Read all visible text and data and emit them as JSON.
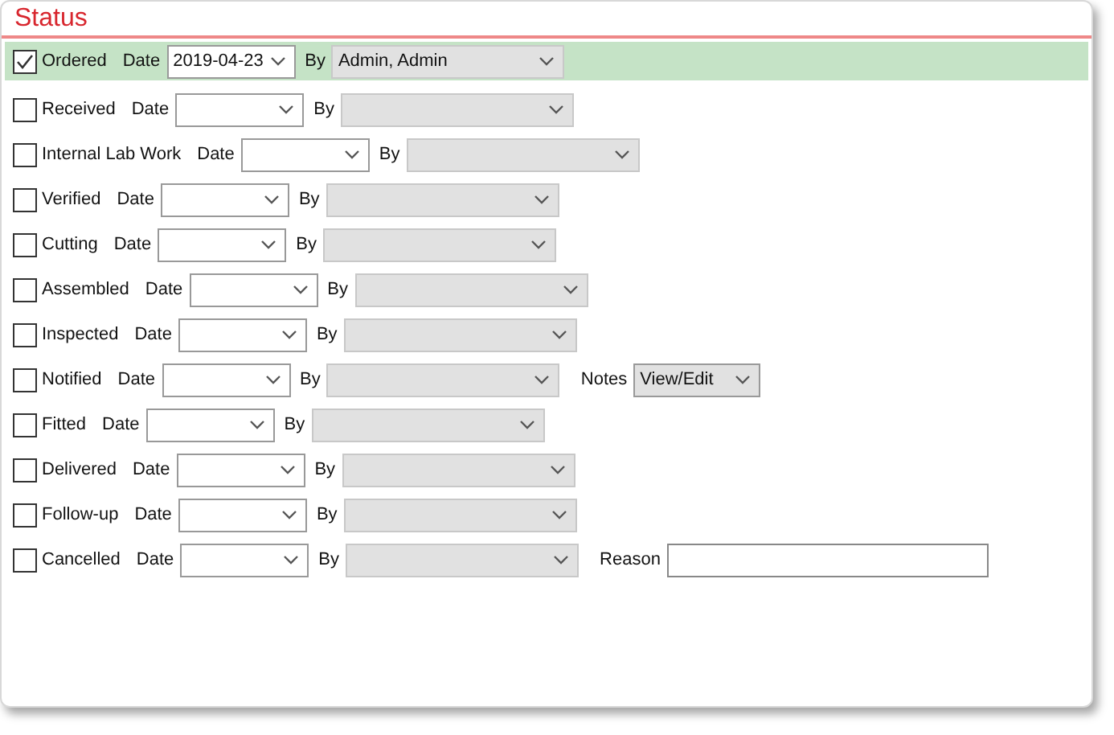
{
  "panel": {
    "title": "Status"
  },
  "rows": [
    {
      "label": "Ordered",
      "checked": true,
      "selected": true,
      "date_label": "Date",
      "date": "2019-04-23",
      "by_label": "By",
      "by": "Admin, Admin"
    },
    {
      "label": "Received",
      "checked": false,
      "selected": false,
      "date_label": "Date",
      "by_label": "By"
    },
    {
      "label": "Internal Lab Work",
      "checked": false,
      "selected": false,
      "date_label": "Date",
      "by_label": "By"
    },
    {
      "label": "Verified",
      "checked": false,
      "selected": false,
      "date_label": "Date",
      "by_label": "By"
    },
    {
      "label": "Cutting",
      "checked": false,
      "selected": false,
      "date_label": "Date",
      "by_label": "By"
    },
    {
      "label": "Assembled",
      "checked": false,
      "selected": false,
      "date_label": "Date",
      "by_label": "By"
    },
    {
      "label": "Inspected",
      "checked": false,
      "selected": false,
      "date_label": "Date",
      "by_label": "By"
    },
    {
      "label": "Notified",
      "checked": false,
      "selected": false,
      "date_label": "Date",
      "by_label": "By",
      "extra": {
        "kind": "notes",
        "label": "Notes",
        "value": "View/Edit"
      }
    },
    {
      "label": "Fitted",
      "checked": false,
      "selected": false,
      "date_label": "Date",
      "by_label": "By"
    },
    {
      "label": "Delivered",
      "checked": false,
      "selected": false,
      "date_label": "Date",
      "by_label": "By"
    },
    {
      "label": "Follow-up",
      "checked": false,
      "selected": false,
      "date_label": "Date",
      "by_label": "By"
    },
    {
      "label": "Cancelled",
      "checked": false,
      "selected": false,
      "date_label": "Date",
      "by_label": "By",
      "extra": {
        "kind": "reason",
        "label": "Reason"
      }
    }
  ]
}
